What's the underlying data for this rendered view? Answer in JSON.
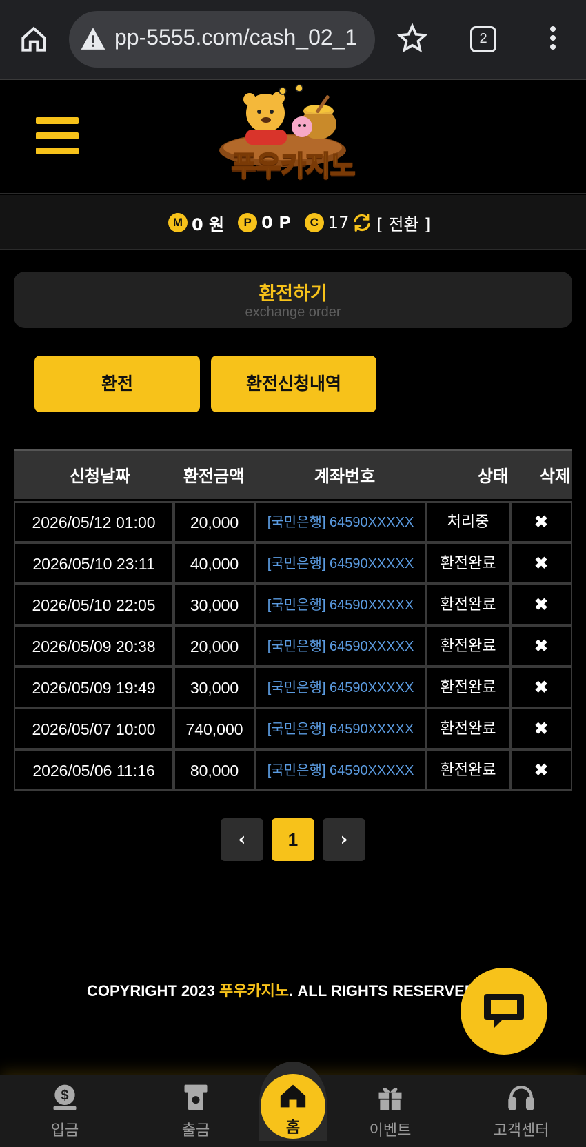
{
  "browser": {
    "url": "pp-5555.com/cash_02_1",
    "tab_count": "2"
  },
  "header": {
    "logo_text": "푸우카지노"
  },
  "balance": {
    "money_icon": "M",
    "money": "0 원",
    "point_icon": "P",
    "point": "0 P",
    "coin_icon": "C",
    "coin": "17",
    "convert_label": "[ 전환 ]"
  },
  "page_title": {
    "ko": "환전하기",
    "en": "exchange order"
  },
  "buttons": {
    "exchange": "환전",
    "history": "환전신청내역"
  },
  "table": {
    "headers": [
      "신청날짜",
      "환전금액",
      "계좌번호",
      "상태",
      "삭제"
    ],
    "rows": [
      {
        "date": "2026/05/12 01:00",
        "amount": "20,000",
        "account": "[국민은행] 64590XXXXX",
        "status": "처리중",
        "delete": "✖"
      },
      {
        "date": "2026/05/10 23:11",
        "amount": "40,000",
        "account": "[국민은행] 64590XXXXX",
        "status": "환전완료",
        "delete": "✖"
      },
      {
        "date": "2026/05/10 22:05",
        "amount": "30,000",
        "account": "[국민은행] 64590XXXXX",
        "status": "환전완료",
        "delete": "✖"
      },
      {
        "date": "2026/05/09 20:38",
        "amount": "20,000",
        "account": "[국민은행] 64590XXXXX",
        "status": "환전완료",
        "delete": "✖"
      },
      {
        "date": "2026/05/09 19:49",
        "amount": "30,000",
        "account": "[국민은행] 64590XXXXX",
        "status": "환전완료",
        "delete": "✖"
      },
      {
        "date": "2026/05/07 10:00",
        "amount": "740,000",
        "account": "[국민은행] 64590XXXXX",
        "status": "환전완료",
        "delete": "✖"
      },
      {
        "date": "2026/05/06 11:16",
        "amount": "80,000",
        "account": "[국민은행] 64590XXXXX",
        "status": "환전완료",
        "delete": "✖"
      }
    ]
  },
  "pagination": {
    "prev": "‹",
    "current": "1",
    "next": "›"
  },
  "footer": {
    "copyright_prefix": "COPYRIGHT 2023 ",
    "brand": "푸우카지노",
    "copyright_suffix": ". ALL RIGHTS RESERVED"
  },
  "bottom_nav": {
    "deposit": "입금",
    "withdraw": "출금",
    "home": "홈",
    "event": "이벤트",
    "support": "고객센터"
  },
  "colors": {
    "accent": "#f7c21a",
    "link": "#5b9be0",
    "background": "#000000"
  }
}
